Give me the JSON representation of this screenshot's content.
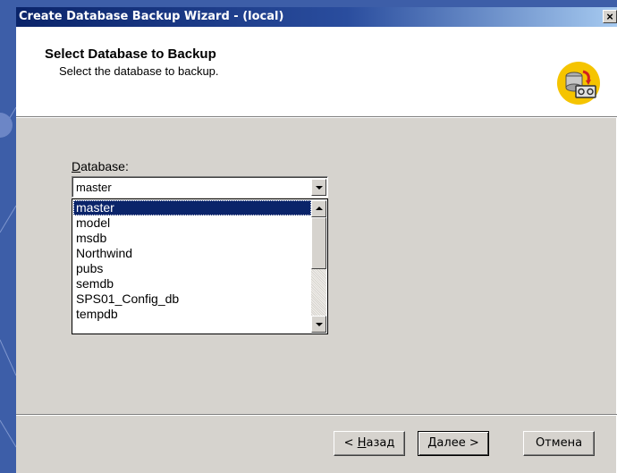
{
  "window": {
    "title": "Create Database Backup Wizard - (local)",
    "close_label": "×"
  },
  "header": {
    "title": "Select Database to Backup",
    "subtitle": "Select the database to backup.",
    "icon": "database-backup-icon"
  },
  "database": {
    "label_prefix": "",
    "label_accel": "D",
    "label_rest": "atabase:",
    "selected": "master",
    "options": [
      "master",
      "model",
      "msdb",
      "Northwind",
      "pubs",
      "semdb",
      "SPS01_Config_db",
      "tempdb"
    ],
    "highlighted_index": 0
  },
  "buttons": {
    "back": {
      "prefix": "< ",
      "accel": "Н",
      "rest": "азад"
    },
    "next": {
      "prefix": "",
      "accel": "Д",
      "rest": "алее >"
    },
    "cancel": "Отмена"
  },
  "colors": {
    "titlebar_start": "#0a246a",
    "titlebar_end": "#a6caf0",
    "selection": "#0a246a",
    "face": "#d6d3ce",
    "desktop": "#3d5ea8"
  }
}
